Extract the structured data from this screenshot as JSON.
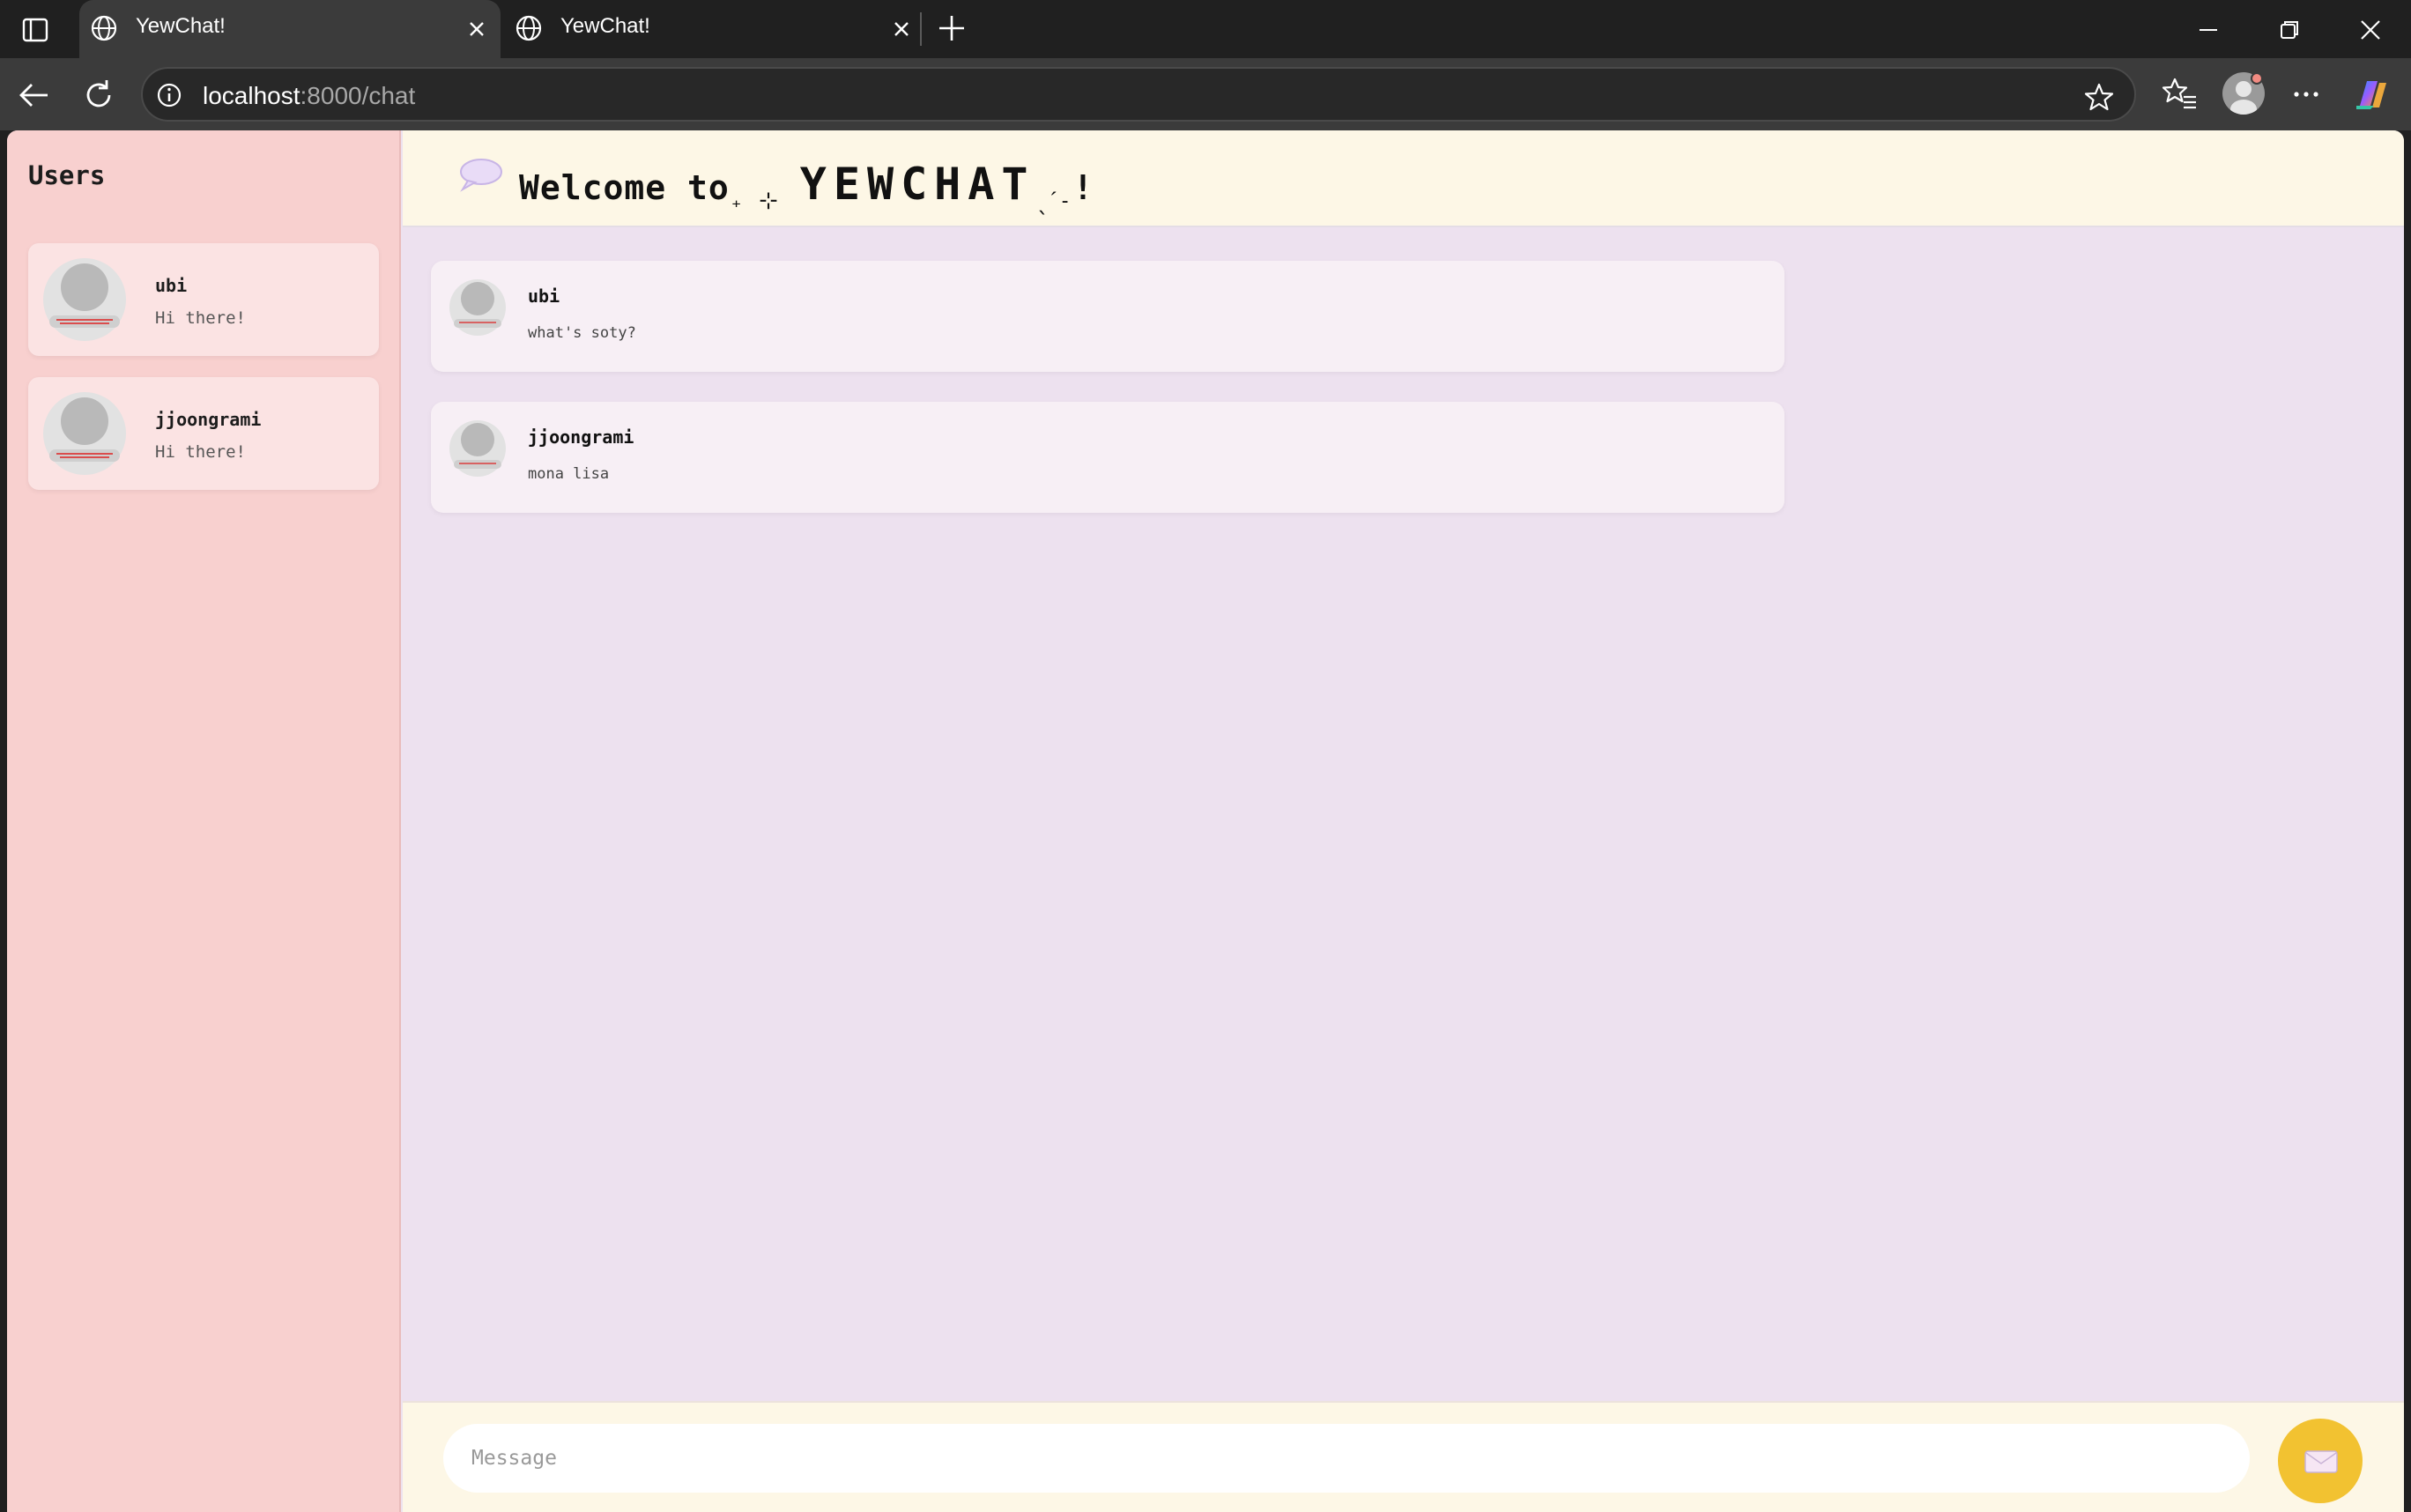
{
  "browser": {
    "tabs": [
      {
        "title": "YewChat!",
        "active": true
      },
      {
        "title": "YewChat!",
        "active": false
      }
    ],
    "address": {
      "host": "localhost",
      "path": ":8000/chat"
    }
  },
  "sidebar": {
    "title": "Users",
    "users": [
      {
        "name": "ubi",
        "status": "Hi there!"
      },
      {
        "name": "jjoongrami",
        "status": "Hi there!"
      }
    ]
  },
  "header": {
    "welcome": "Welcome to",
    "deco_left": "₊ ⊹",
    "brand": "YEWCHAT",
    "deco_right": "ˎˊ˗",
    "exclaim": "!"
  },
  "messages": [
    {
      "from": "ubi",
      "text": "what's soty?"
    },
    {
      "from": "jjoongrami",
      "text": "mona lisa"
    }
  ],
  "composer": {
    "placeholder": "Message"
  },
  "colors": {
    "sidebar_bg": "#f8d0cf",
    "chat_bg": "#ede1ef",
    "header_bg": "#fdf7e6",
    "send_button": "#f2c231"
  },
  "icons": [
    "sidebar-toggle-icon",
    "globe-icon",
    "close-icon",
    "plus-icon",
    "minimize-icon",
    "restore-icon",
    "back-icon",
    "reload-icon",
    "info-icon",
    "star-icon",
    "favorites-icon",
    "profile-icon",
    "more-icon",
    "copilot-icon",
    "speech-bubble-icon",
    "send-icon"
  ]
}
